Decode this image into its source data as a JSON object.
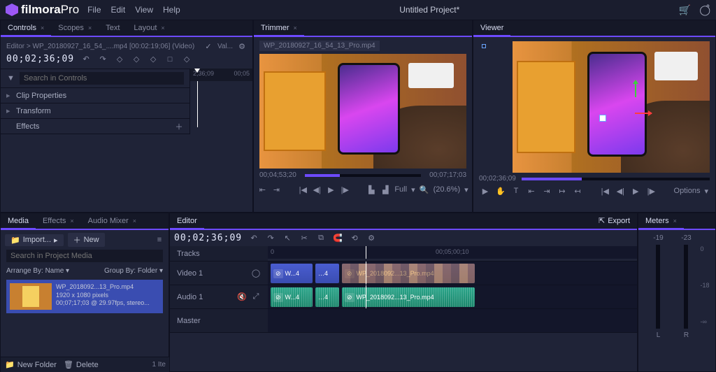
{
  "app": {
    "name_a": "filmora",
    "name_b": "Pro",
    "title": "Untitled Project*"
  },
  "menu": [
    "File",
    "Edit",
    "View",
    "Help"
  ],
  "controls": {
    "tabs": [
      "Controls",
      "Scopes",
      "Text",
      "Layout"
    ],
    "path": "Editor > WP_20180927_16_54_....mp4 [00:02:19;06] (Video)",
    "val": "Val...",
    "timecode": "00;02;36;09",
    "search_ph": "Search in Controls",
    "ruler_a": "2;36;09",
    "ruler_b": "00;05",
    "rows": [
      "Clip Properties",
      "Transform",
      "Effects"
    ]
  },
  "trimmer": {
    "tab": "Trimmer",
    "filename": "WP_20180927_16_54_13_Pro.mp4",
    "tc_left": "00;04;53;20",
    "tc_right": "00;07;17;03",
    "full": "Full",
    "zoom": "(20.6%)"
  },
  "viewer": {
    "tab": "Viewer",
    "tc": "00;02;36;09",
    "options": "Options"
  },
  "media": {
    "tabs": [
      "Media",
      "Effects",
      "Audio Mixer"
    ],
    "import": "Import...",
    "new": "New",
    "search_ph": "Search in Project Media",
    "arrange": "Arrange By: Name",
    "group": "Group By: Folder",
    "thumb_name": "WP_2018092...13_Pro.mp4",
    "thumb_dim": "1920 x 1080 pixels",
    "thumb_meta": "00;07;17;03 @ 29.97fps, stereo...",
    "newfolder": "New Folder",
    "delete": "Delete",
    "count": "1 Ite"
  },
  "editor": {
    "tab": "Editor",
    "timecode": "00;02;36;09",
    "export": "Export",
    "tracks_label": "Tracks",
    "ruler_zero": "0",
    "ruler_mid": "00;05;00;10",
    "tracks": [
      "Video 1",
      "Audio 1",
      "Master"
    ],
    "clip_short": "W...4",
    "clip_long": "WP_2018092...13_Pro.mp4"
  },
  "meters": {
    "tab": "Meters",
    "l": "-19",
    "r": "-23",
    "zero": "0",
    "n18": "-18",
    "ninf": "-∞",
    "L": "L",
    "R": "R"
  }
}
